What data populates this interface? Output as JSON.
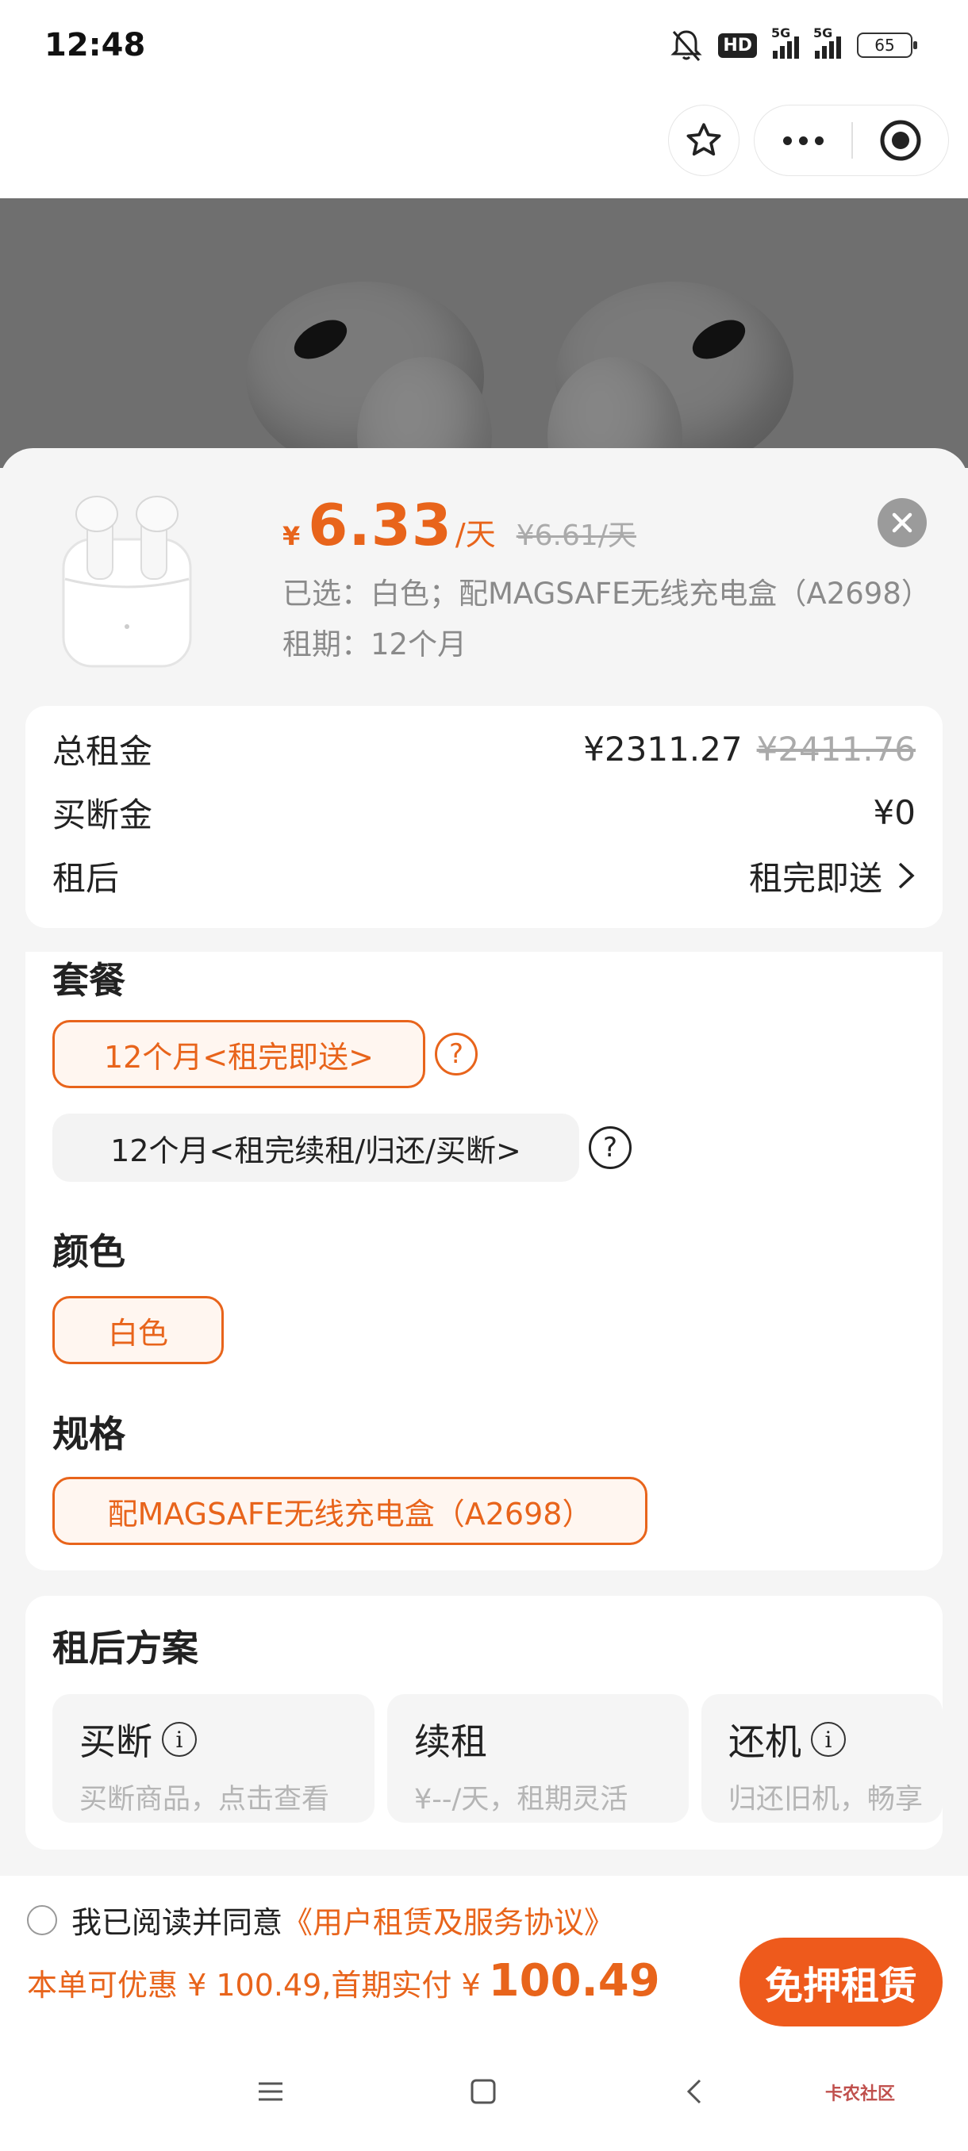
{
  "status_bar": {
    "time": "12:48",
    "hd_label": "HD",
    "sim1": "5G",
    "sim2": "5G",
    "battery": "65"
  },
  "product": {
    "price_symbol": "¥",
    "price": "6.33",
    "price_unit": "/天",
    "original_price": "¥6.61/天",
    "selected": "已选：白色；配MAGSAFE无线充电盒（A2698）",
    "period": "租期：12个月"
  },
  "summary": {
    "rows": [
      {
        "label": "总租金",
        "value": "¥2311.27",
        "old": "¥2411.76"
      },
      {
        "label": "买断金",
        "value": "¥0"
      },
      {
        "label": "租后",
        "value": "租完即送"
      }
    ]
  },
  "options": {
    "package_title": "套餐",
    "packages": [
      "12个月<租完即送>",
      "12个月<租完续租/归还/买断>"
    ],
    "color_title": "颜色",
    "colors": [
      "白色"
    ],
    "spec_title": "规格",
    "specs": [
      "配MAGSAFE无线充电盒（A2698）"
    ],
    "help_glyph": "?"
  },
  "after_plan": {
    "title": "租后方案",
    "plans": [
      {
        "title": "买断",
        "desc": "买断商品，点击查看"
      },
      {
        "title": "续租",
        "desc": "¥--/天，租期灵活"
      },
      {
        "title": "还机",
        "desc": "归还旧机，畅享"
      }
    ]
  },
  "footer": {
    "agree_text": "我已阅读并同意",
    "agree_link": "《用户租赁及服务协议》",
    "promo_text": "本单可优惠 ¥ 100.49,首期实付 ¥",
    "first_payment": "100.49",
    "rent_button": "免押租赁"
  },
  "watermark": "卡农社区",
  "colors": {
    "accent": "#e8641b",
    "button": "#ee5a1c"
  }
}
